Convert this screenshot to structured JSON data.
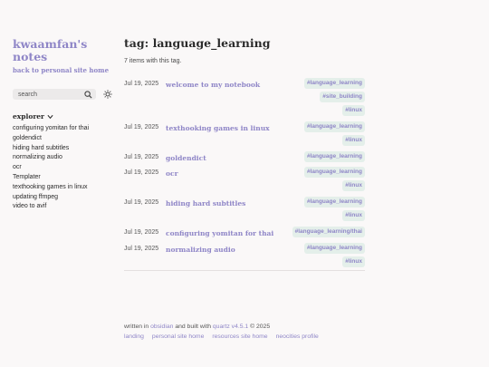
{
  "sidebar": {
    "site_title": "kwaamfan's notes",
    "back_link": "back to personal site home",
    "search_placeholder": "search",
    "explorer_title": "explorer",
    "items": [
      "configuring yomitan for thai",
      "goldendict",
      "hiding hard subtitles",
      "normalizing audio",
      "ocr",
      "Templater",
      "texthooking games in linux",
      "updating ffmpeg",
      "video to avif"
    ]
  },
  "main": {
    "title": "tag: language_learning",
    "count": "7 items with this tag.",
    "entries": [
      {
        "date": "Jul 19, 2025",
        "title": "welcome to my notebook",
        "tags": [
          "#language_learning",
          "#site_building",
          "#linux"
        ]
      },
      {
        "date": "Jul 19, 2025",
        "title": "texthooking games in linux",
        "tags": [
          "#language_learning",
          "#linux"
        ]
      },
      {
        "date": "Jul 19, 2025",
        "title": "goldendict",
        "tags": [
          "#language_learning"
        ]
      },
      {
        "date": "Jul 19, 2025",
        "title": "ocr",
        "tags": [
          "#language_learning",
          "#linux"
        ]
      },
      {
        "date": "Jul 19, 2025",
        "title": "hiding hard subtitles",
        "tags": [
          "#language_learning",
          "#linux"
        ]
      },
      {
        "date": "Jul 19, 2025",
        "title": "configuring yomitan for thai",
        "tags": [
          "#language_learning/thai"
        ]
      },
      {
        "date": "Jul 19, 2025",
        "title": "normalizing audio",
        "tags": [
          "#language_learning",
          "#linux"
        ]
      }
    ]
  },
  "footer": {
    "written_in": "written in",
    "obsidian": "obsidian",
    "built_with": "and built with",
    "quartz": "quartz v4.5.1",
    "copyright": "© 2025",
    "links": [
      "landing",
      "personal site home",
      "resources site home",
      "neocities profile"
    ]
  },
  "colors": {
    "accent": "#8f86c7",
    "tag_bg": "#e4efea",
    "background": "#faf8f8"
  },
  "icons": {
    "search": "search-icon",
    "darkmode": "sun-icon",
    "explorer": "chevron-down-icon"
  }
}
